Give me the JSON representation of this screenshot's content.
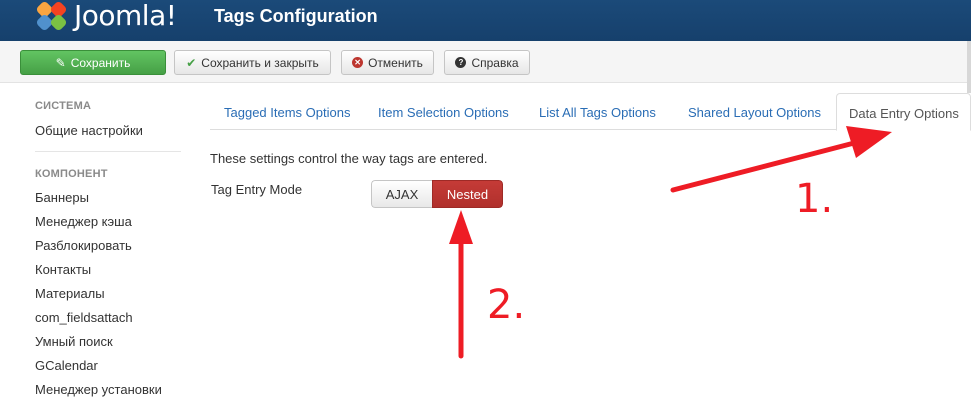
{
  "header": {
    "brand": "Joomla!",
    "title": "Tags Configuration",
    "colors": {
      "bar": "#1b4a79",
      "logo": [
        "#f9a541",
        "#f44321",
        "#5091cd",
        "#7ac143"
      ]
    }
  },
  "toolbar": {
    "save": "Сохранить",
    "save_close": "Сохранить и закрыть",
    "cancel": "Отменить",
    "help": "Справка",
    "icons": [
      "edit-icon",
      "check-icon",
      "cancel-icon",
      "question-icon"
    ]
  },
  "sidebar": {
    "system_heading": "СИСТЕМА",
    "system_items": [
      "Общие настройки"
    ],
    "component_heading": "КОМПОНЕНТ",
    "component_items": [
      "Баннеры",
      "Менеджер кэша",
      "Разблокировать",
      "Контакты",
      "Материалы",
      "com_fieldsattach",
      "Умный поиск",
      "GCalendar",
      "Менеджер установки"
    ]
  },
  "tabs": [
    "Tagged Items Options",
    "Item Selection Options",
    "List All Tags Options",
    "Shared Layout Options",
    "Data Entry Options"
  ],
  "active_tab": "Data Entry Options",
  "content": {
    "description": "These settings control the way tags are entered.",
    "field_label": "Tag Entry Mode",
    "options": [
      "AJAX",
      "Nested"
    ],
    "selected": "Nested",
    "selected_color": "#bd362f"
  },
  "annotations": {
    "marker_1": "1.",
    "marker_2": "2.",
    "color": "#ee1c25"
  }
}
